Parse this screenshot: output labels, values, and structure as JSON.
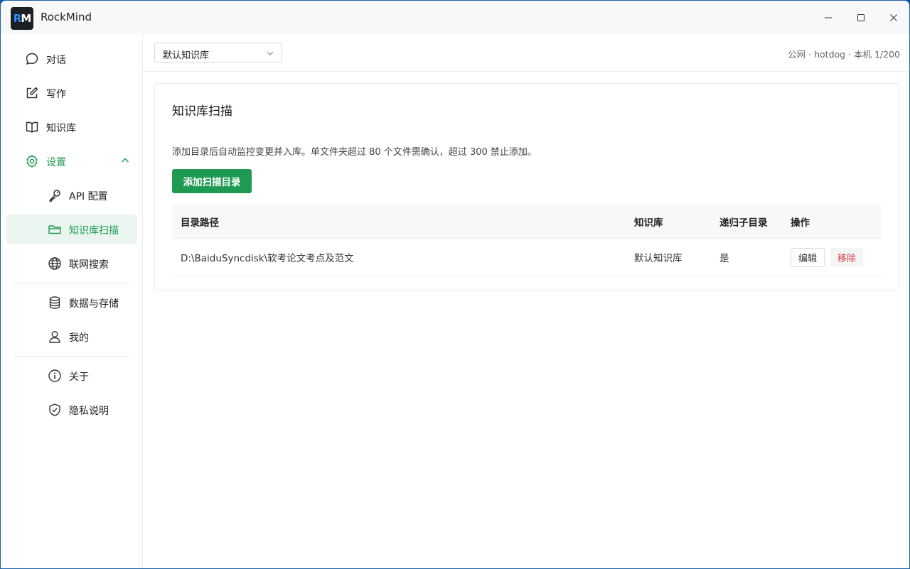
{
  "window": {
    "title": "RockMind",
    "logo_text_r": "R",
    "logo_text_m": "M"
  },
  "sidebar": {
    "items": [
      {
        "label": "对话",
        "icon": "chat-bubble-icon"
      },
      {
        "label": "写作",
        "icon": "edit-icon"
      },
      {
        "label": "知识库",
        "icon": "book-icon"
      },
      {
        "label": "设置",
        "icon": "gear-icon"
      },
      {
        "label": "API 配置",
        "icon": "key-icon"
      },
      {
        "label": "知识库扫描",
        "icon": "folder-icon"
      },
      {
        "label": "联网搜索",
        "icon": "globe-icon"
      },
      {
        "label": "数据与存储",
        "icon": "database-icon"
      },
      {
        "label": "我的",
        "icon": "user-icon"
      },
      {
        "label": "关于",
        "icon": "info-icon"
      },
      {
        "label": "隐私说明",
        "icon": "shield-icon"
      }
    ]
  },
  "topbar": {
    "kb_select_value": "默认知识库",
    "status": "公网 · hotdog · 本机 1/200"
  },
  "main": {
    "title": "知识库扫描",
    "description": "添加目录后自动监控变更并入库。单文件夹超过 80 个文件需确认，超过 300 禁止添加。",
    "add_button": "添加扫描目录",
    "table": {
      "headers": [
        "目录路径",
        "知识库",
        "递归子目录",
        "操作"
      ],
      "rows": [
        {
          "path": "D:\\BaiduSyncdisk\\软考论文考点及范文",
          "kb": "默认知识库",
          "recursive": "是",
          "edit": "编辑",
          "remove": "移除"
        }
      ]
    }
  },
  "colors": {
    "accent": "#1e9a53",
    "active_bg": "#e9f5ee",
    "danger": "#d9363e"
  }
}
